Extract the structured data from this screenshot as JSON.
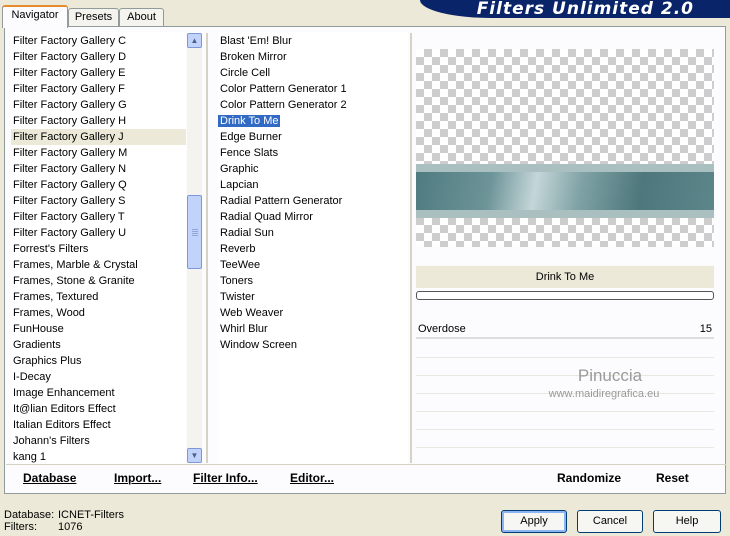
{
  "tabs": [
    {
      "label": "Navigator",
      "active": true
    },
    {
      "label": "Presets",
      "active": false
    },
    {
      "label": "About",
      "active": false
    }
  ],
  "banner_title": "Filters Unlimited 2.0",
  "categories": [
    "Filter Factory Gallery C",
    "Filter Factory Gallery D",
    "Filter Factory Gallery E",
    "Filter Factory Gallery F",
    "Filter Factory Gallery G",
    "Filter Factory Gallery H",
    "Filter Factory Gallery J",
    "Filter Factory Gallery M",
    "Filter Factory Gallery N",
    "Filter Factory Gallery Q",
    "Filter Factory Gallery S",
    "Filter Factory Gallery T",
    "Filter Factory Gallery U",
    "Forrest's Filters",
    "Frames, Marble & Crystal",
    "Frames, Stone & Granite",
    "Frames, Textured",
    "Frames, Wood",
    "FunHouse",
    "Gradients",
    "Graphics Plus",
    "I-Decay",
    "Image Enhancement",
    "It@lian Editors Effect",
    "Italian Editors Effect",
    "Johann's Filters",
    "kang 1"
  ],
  "selected_category": "Filter Factory Gallery J",
  "filters": [
    "Blast 'Em! Blur",
    "Broken Mirror",
    "Circle Cell",
    "Color Pattern Generator 1",
    "Color Pattern Generator 2",
    "Drink To Me",
    "Edge Burner",
    "Fence Slats",
    "Graphic",
    "Lapcian",
    "Radial Pattern Generator",
    "Radial Quad Mirror",
    "Radial Sun",
    "Reverb",
    "TeeWee",
    "Toners",
    "Twister",
    "Web Weaver",
    "Whirl Blur",
    "Window Screen"
  ],
  "selected_filter": "Drink To Me",
  "preview_filter_name": "Drink To Me",
  "parameters": [
    {
      "name": "Overdose",
      "value": "15"
    }
  ],
  "watermark": {
    "line1": "Pinuccia",
    "line2": "www.maidiregrafica.eu"
  },
  "bottom_links": {
    "database": "Database",
    "import": "Import...",
    "filter_info": "Filter Info...",
    "editor": "Editor...",
    "randomize": "Randomize",
    "reset": "Reset"
  },
  "status": {
    "database_label": "Database:",
    "database_value": "ICNET-Filters",
    "filters_label": "Filters:",
    "filters_value": "1076"
  },
  "buttons": {
    "apply": "Apply",
    "cancel": "Cancel",
    "help": "Help"
  },
  "colors": {
    "selection": "#316ac5",
    "banner": "#0a246a",
    "accent_tab": "#e68b2c"
  }
}
